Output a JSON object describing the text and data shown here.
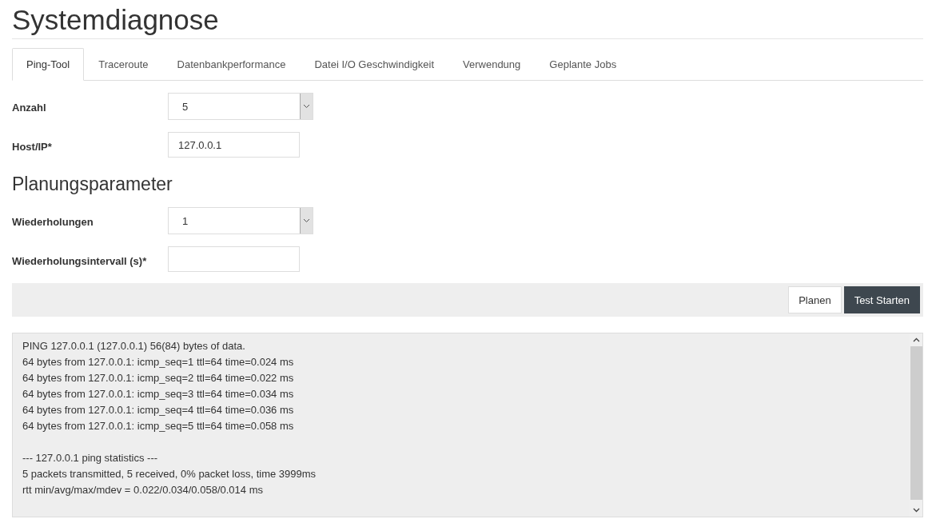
{
  "title": "Systemdiagnose",
  "tabs": [
    {
      "label": "Ping-Tool",
      "selected": true
    },
    {
      "label": "Traceroute",
      "selected": false
    },
    {
      "label": "Datenbankperformance",
      "selected": false
    },
    {
      "label": "Datei I/O Geschwindigkeit",
      "selected": false
    },
    {
      "label": "Verwendung",
      "selected": false
    },
    {
      "label": "Geplante Jobs",
      "selected": false
    }
  ],
  "fields": [
    {
      "label": "Anzahl",
      "kind": "select",
      "value": "5"
    },
    {
      "label": "Host/IP*",
      "kind": "text",
      "value": "127.0.0.1"
    }
  ],
  "schedule": {
    "heading": "Planungsparameter",
    "fields": [
      {
        "label": "Wiederholungen",
        "kind": "select",
        "value": "1"
      },
      {
        "label": "Wiederholungsintervall (s)*",
        "kind": "text"
      }
    ]
  },
  "buttons": [
    {
      "label": "Planen",
      "kind": "default"
    },
    {
      "label": "Test Starten",
      "kind": "primary"
    }
  ],
  "output": {
    "blocks": [
      [
        "PING 127.0.0.1 (127.0.0.1) 56(84) bytes of data.",
        "64 bytes from 127.0.0.1: icmp_seq=1 ttl=64 time=0.024 ms",
        "64 bytes from 127.0.0.1: icmp_seq=2 ttl=64 time=0.022 ms",
        "64 bytes from 127.0.0.1: icmp_seq=3 ttl=64 time=0.034 ms",
        "64 bytes from 127.0.0.1: icmp_seq=4 ttl=64 time=0.036 ms",
        "64 bytes from 127.0.0.1: icmp_seq=5 ttl=64 time=0.058 ms"
      ],
      [
        "--- 127.0.0.1 ping statistics ---",
        "5 packets transmitted, 5 received, 0% packet loss, time 3999ms",
        "rtt min/avg/max/mdev = 0.022/0.034/0.058/0.014 ms"
      ]
    ]
  }
}
